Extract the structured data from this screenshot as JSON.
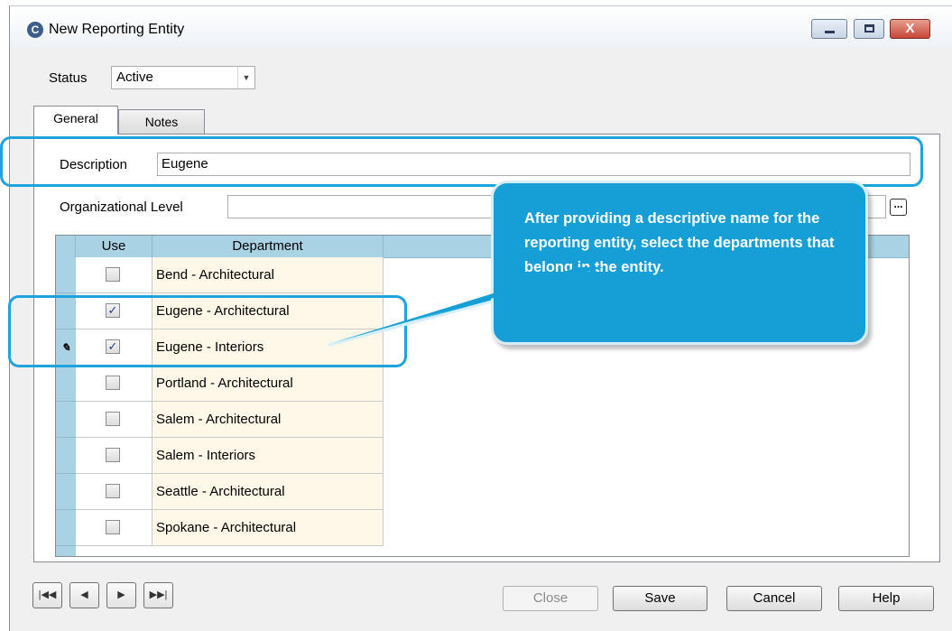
{
  "window": {
    "title": "New Reporting Entity",
    "close_glyph": "X"
  },
  "status": {
    "label": "Status",
    "value": "Active"
  },
  "tabs": [
    {
      "label": "General",
      "active": true
    },
    {
      "label": "Notes",
      "active": false
    }
  ],
  "description": {
    "label": "Description",
    "value": "Eugene"
  },
  "org_level": {
    "label": "Organizational Level",
    "value": "",
    "browse_label": "..."
  },
  "grid": {
    "columns": [
      "Use",
      "Department"
    ],
    "rows": [
      {
        "department": "Bend - Architectural",
        "checked": false,
        "current": false
      },
      {
        "department": "Eugene - Architectural",
        "checked": true,
        "current": false
      },
      {
        "department": "Eugene - Interiors",
        "checked": true,
        "current": true
      },
      {
        "department": "Portland - Architectural",
        "checked": false,
        "current": false
      },
      {
        "department": "Salem - Architectural",
        "checked": false,
        "current": false
      },
      {
        "department": "Salem - Interiors",
        "checked": false,
        "current": false
      },
      {
        "department": "Seattle - Architectural",
        "checked": false,
        "current": false
      },
      {
        "department": "Spokane - Architectural",
        "checked": false,
        "current": false
      }
    ]
  },
  "navigation": [
    "first-record-icon",
    "previous-record-icon",
    "next-record-icon",
    "last-record-icon"
  ],
  "buttons": {
    "close": "Close",
    "save": "Save",
    "cancel": "Cancel",
    "help": "Help"
  },
  "callout": {
    "text": "After providing a descriptive name for the reporting entity, select the departments that belong in the entity."
  },
  "colors": {
    "callout": "#169fd6",
    "highlight": "#1fa3dc",
    "grid_header": "#a9d3e4",
    "department_cell": "#fff7e7"
  }
}
